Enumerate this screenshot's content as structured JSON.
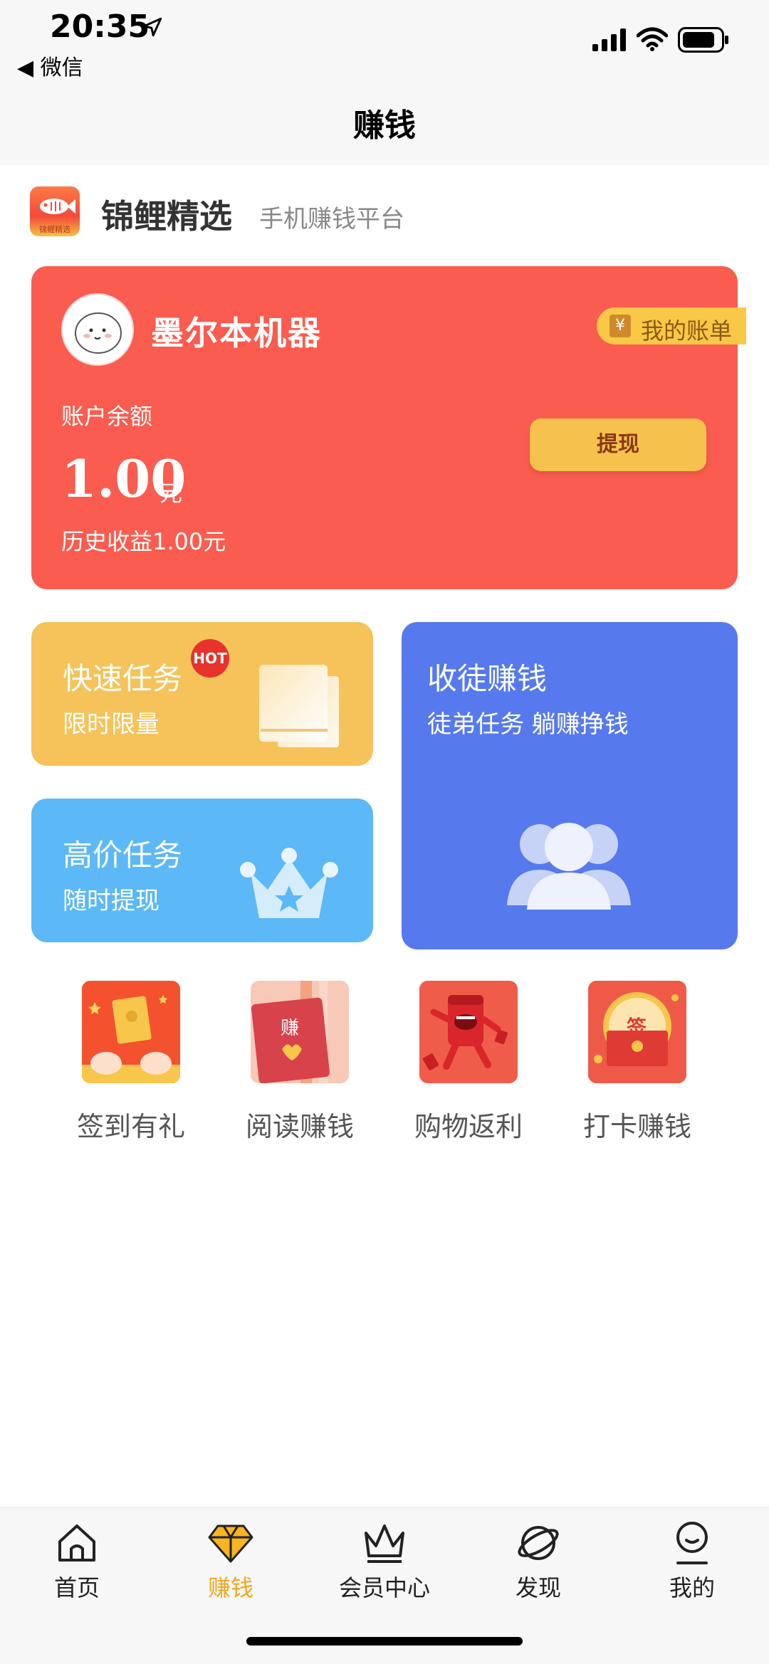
{
  "status_bar": {
    "time": "20:35",
    "back_label": "◀ 微信"
  },
  "nav": {
    "title": "赚钱"
  },
  "brand": {
    "name": "锦鲤精选",
    "slogan": "手机赚钱平台",
    "logo_text": "锦鲤精选"
  },
  "account": {
    "username": "墨尔本机器",
    "bill_label": "我的账单",
    "balance_label": "账户余额",
    "balance": "1.00",
    "balance_unit": "元",
    "history": "历史收益1.00元",
    "withdraw_label": "提现"
  },
  "tasks": {
    "quick": {
      "title": "快速任务",
      "subtitle": "限时限量",
      "badge": "HOT"
    },
    "high": {
      "title": "高价任务",
      "subtitle": "随时提现"
    },
    "recruit": {
      "title": "收徒赚钱",
      "subtitle": "徒弟任务 躺赚挣钱"
    }
  },
  "quick_actions": [
    {
      "label": "签到有礼",
      "icon": "red-envelope-hands-icon"
    },
    {
      "label": "阅读赚钱",
      "icon": "book-icon",
      "icon_text": "赚"
    },
    {
      "label": "购物返利",
      "icon": "red-packet-mascot-icon"
    },
    {
      "label": "打卡赚钱",
      "icon": "sign-envelope-icon",
      "icon_text": "签"
    }
  ],
  "tabbar": [
    {
      "label": "首页",
      "icon": "home-icon",
      "active": false
    },
    {
      "label": "赚钱",
      "icon": "diamond-icon",
      "active": true
    },
    {
      "label": "会员中心",
      "icon": "crown-icon",
      "active": false
    },
    {
      "label": "发现",
      "icon": "planet-icon",
      "active": false
    },
    {
      "label": "我的",
      "icon": "user-icon",
      "active": false
    }
  ],
  "colors": {
    "account_card": "#fa5c4f",
    "quick_tile": "#f5c35a",
    "high_tile": "#5cb8f7",
    "recruit_tile": "#5679ee",
    "tab_active": "#f0a61c"
  }
}
